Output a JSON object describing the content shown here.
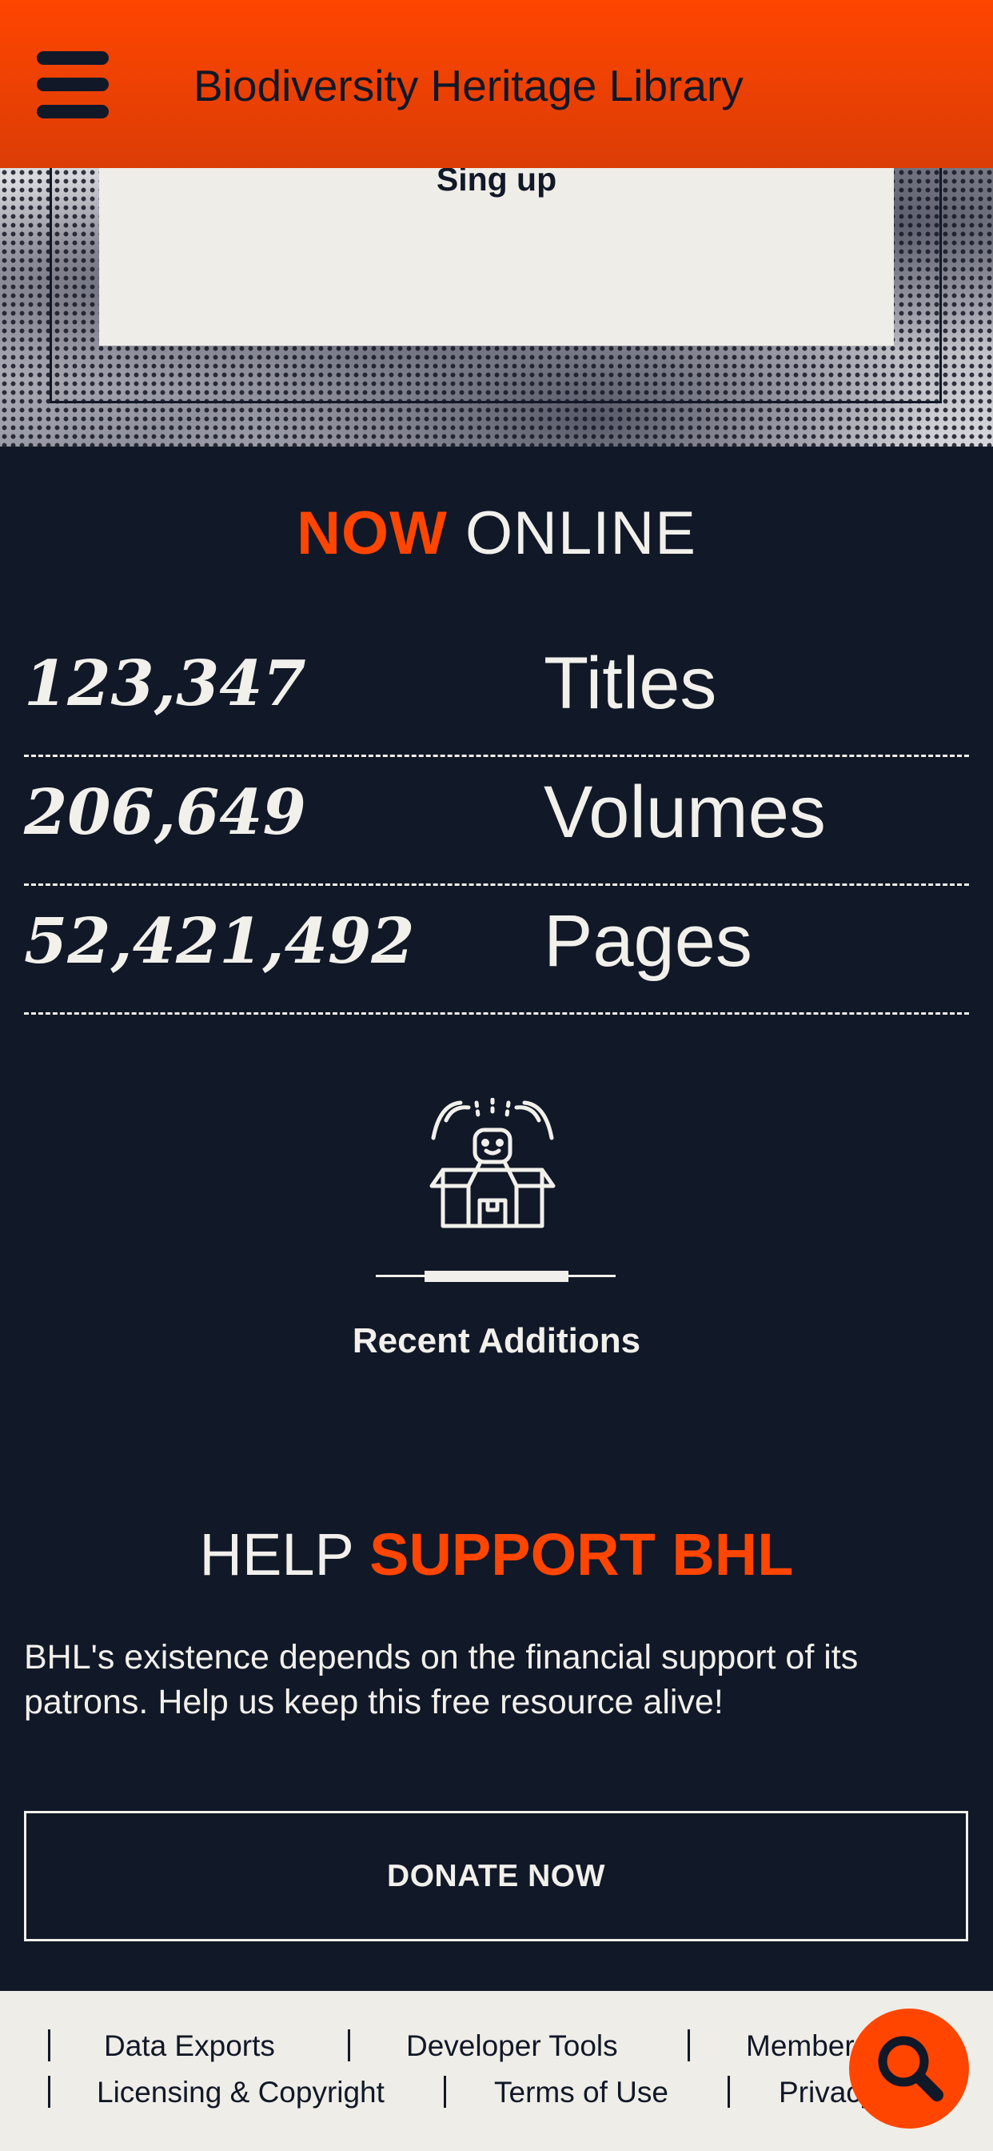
{
  "header": {
    "title": "Biodiversity Heritage Library",
    "menu_icon": "hamburger-menu-icon"
  },
  "banner": {
    "signup_label": "Sing up"
  },
  "now_online": {
    "accent": "NOW",
    "rest": " ONLINE"
  },
  "stats": [
    {
      "value": "123,347",
      "label": "Titles"
    },
    {
      "value": "206,649",
      "label": "Volumes"
    },
    {
      "value": "52,421,492",
      "label": "Pages"
    }
  ],
  "recent_additions": {
    "icon": "gift-box-icon",
    "label": "Recent Additions"
  },
  "help": {
    "plain": "HELP ",
    "accent": "SUPPORT BHL",
    "text": "BHL's existence depends on the financial support of its patrons. Help us keep this free resource alive!",
    "donate_label": "DONATE NOW"
  },
  "footer": {
    "row1": [
      "Data Exports",
      "Developer Tools",
      "Members"
    ],
    "row2": [
      "Licensing & Copyright",
      "Terms of Use",
      "Privacy"
    ]
  },
  "search_fab_icon": "search-icon",
  "colors": {
    "accent": "#ff4500",
    "background": "#111827",
    "light": "#f2f0eb"
  }
}
